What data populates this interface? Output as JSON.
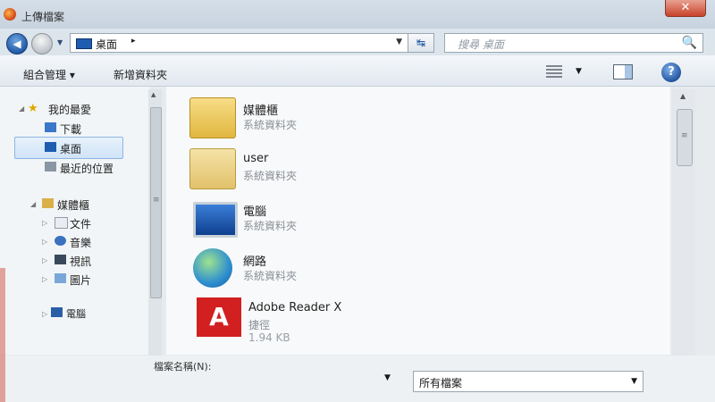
{
  "window": {
    "title": "上傳檔案",
    "close_glyph": "✕"
  },
  "nav": {
    "back_glyph": "◀",
    "address_text": "桌面",
    "address_sep": "▸",
    "dropdown_glyph": "▼",
    "refresh_glyph": "↹",
    "search_placeholder": "搜尋 桌面",
    "search_glyph": "🔍"
  },
  "toolbar": {
    "organize": "組合管理 ▾",
    "new_folder": "新增資料夾",
    "view_drop_glyph": "▼",
    "help_glyph": "?"
  },
  "sidebar": {
    "favorites": "我的最愛",
    "downloads": "下載",
    "desktop": "桌面",
    "recent": "最近的位置",
    "libraries": "媒體櫃",
    "documents": "文件",
    "music": "音樂",
    "videos": "視訊",
    "pictures": "圖片",
    "computer": "電腦",
    "expand_glyph": "▷",
    "collapse_glyph": "◢",
    "star_glyph": "★"
  },
  "files": [
    {
      "name": "媒體櫃",
      "sub": "系統資料夾",
      "icon": "folder-icon"
    },
    {
      "name": "user",
      "sub": "系統資料夾",
      "icon": "user-icon"
    },
    {
      "name": "電腦",
      "sub": "系統資料夾",
      "icon": "computer-icon"
    },
    {
      "name": "網路",
      "sub": "系統資料夾",
      "icon": "network-icon"
    },
    {
      "name": "Adobe Reader X",
      "sub": "捷徑",
      "sub2": "1.94 KB",
      "icon": "pdf-icon"
    }
  ],
  "bottom": {
    "filename_label": "檔案名稱(N):",
    "filename_value": "",
    "filetype": "所有檔案",
    "drop_glyph": "▼"
  },
  "scroll": {
    "up_glyph": "▲",
    "grip_glyph": "≡"
  }
}
